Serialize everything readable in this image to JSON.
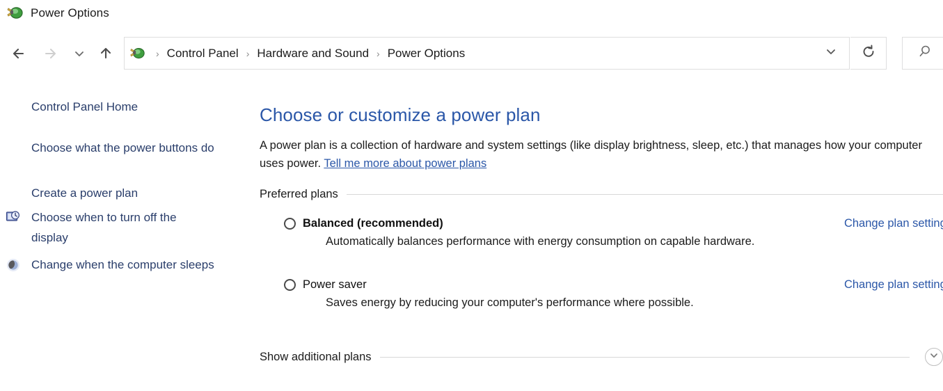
{
  "window": {
    "title": "Power Options",
    "title_icon": "power-plug-icon"
  },
  "navigation": {
    "back_icon": "back-arrow-icon",
    "forward_icon": "forward-arrow-icon",
    "recent_icon": "chevron-down-icon",
    "up_icon": "up-arrow-icon",
    "refresh_icon": "refresh-icon",
    "address_dropdown_icon": "chevron-down-icon",
    "search_icon": "search-icon",
    "search_placeholder": "",
    "search_value": "",
    "breadcrumb": {
      "icon": "power-plug-icon",
      "separator": "›",
      "items": [
        {
          "label": "Control Panel"
        },
        {
          "label": "Hardware and Sound"
        },
        {
          "label": "Power Options"
        }
      ]
    }
  },
  "sidebar": {
    "home_label": "Control Panel Home",
    "items": [
      {
        "label": "Choose what the power buttons do",
        "icon": null
      },
      {
        "label": "Create a power plan",
        "icon": null
      },
      {
        "label": "Choose when to turn off the display",
        "icon": "display-clock-icon"
      },
      {
        "label": "Change when the computer sleeps",
        "icon": "sleep-moon-icon"
      }
    ]
  },
  "main": {
    "title": "Choose or customize a power plan",
    "description_part1": "A power plan is a collection of hardware and system settings (like display brightness, sleep, etc.) that manages how your computer uses power. ",
    "description_link": "Tell me more about power plans",
    "preferred_plans_label": "Preferred plans",
    "plans": [
      {
        "name": "Balanced (recommended)",
        "bold": true,
        "selected": false,
        "description": "Automatically balances performance with energy consumption on capable hardware.",
        "change_link": "Change plan settings"
      },
      {
        "name": "Power saver",
        "bold": false,
        "selected": false,
        "description": "Saves energy by reducing your computer's performance where possible.",
        "change_link": "Change plan settings"
      }
    ],
    "show_additional_label": "Show additional plans",
    "show_additional_icon": "chevron-down-circle-icon"
  },
  "colors": {
    "accent_blue": "#2b57a8",
    "link_blue": "#2a3e6b",
    "text": "#1b1b1b",
    "rule": "#d8d8d8"
  }
}
